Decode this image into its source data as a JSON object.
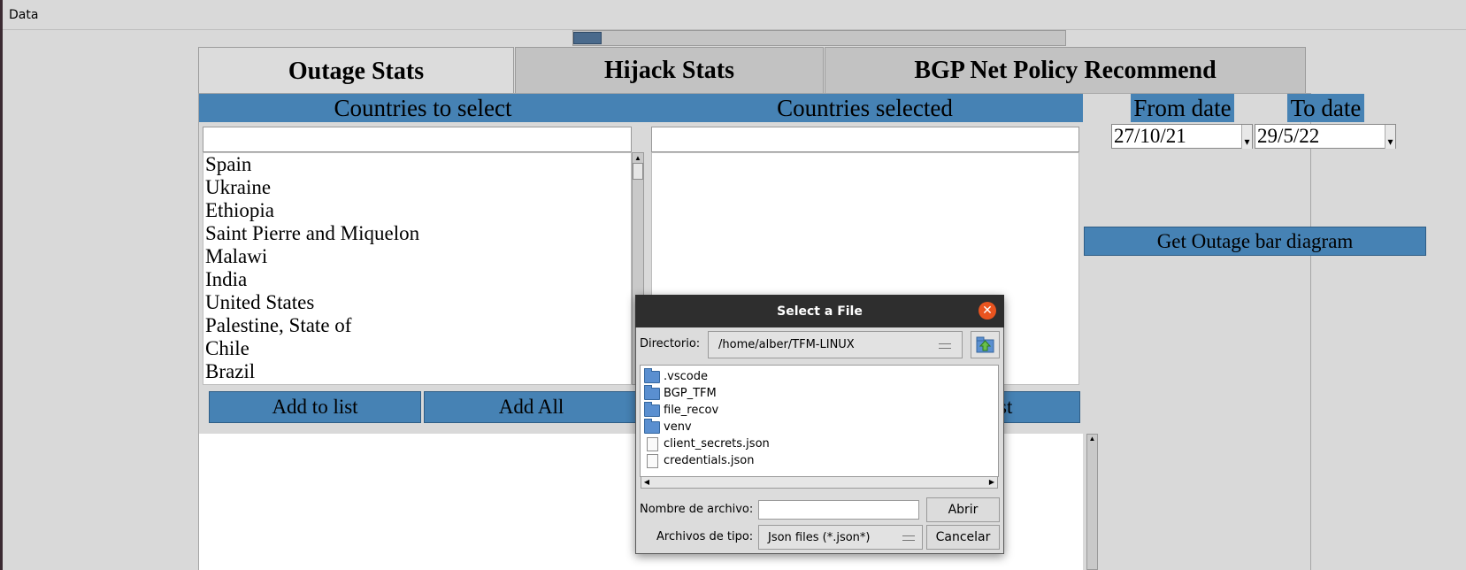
{
  "menu": {
    "data_label": "Data"
  },
  "tabs": [
    {
      "label": "Outage Stats"
    },
    {
      "label": "Hijack Stats"
    },
    {
      "label": "BGP Net Policy Recommend"
    }
  ],
  "outage": {
    "countries_to_select_header": "Countries to select",
    "countries_selected_header": "Countries selected",
    "search_value": "",
    "selected_search_value": "",
    "countries": [
      "Spain",
      "Ukraine",
      "Ethiopia",
      "Saint Pierre and Miquelon",
      "Malawi",
      "India",
      "United States",
      "Palestine, State of",
      "Chile",
      "Brazil"
    ],
    "add_to_list_label": "Add to list",
    "add_all_label": "Add All",
    "remove_partial_label": "st",
    "from_date_label": "From date",
    "to_date_label": "To date",
    "from_date_value": "27/10/21",
    "to_date_value": "29/5/22",
    "get_bar_diagram_label": "Get Outage bar diagram"
  },
  "dialog": {
    "title": "Select a File",
    "directory_label": "Directorio:",
    "directory_value": "/home/alber/TFM-LINUX",
    "files": [
      {
        "name": ".vscode",
        "icon": "folder-icon"
      },
      {
        "name": "BGP_TFM",
        "icon": "folder-icon"
      },
      {
        "name": "file_recov",
        "icon": "folder-icon"
      },
      {
        "name": "venv",
        "icon": "folder-icon"
      },
      {
        "name": "client_secrets.json",
        "icon": "file-icon"
      },
      {
        "name": "credentials.json",
        "icon": "file-icon"
      }
    ],
    "filename_label": "Nombre de archivo:",
    "filename_value": "",
    "filetype_label": "Archivos de tipo:",
    "filetype_value": "Json files (*.json*)",
    "open_label": "Abrir",
    "cancel_label": "Cancelar"
  },
  "colors": {
    "accent": "#4682b4",
    "dialog_title_bg": "#2e2e2e",
    "close_button": "#e9541f"
  }
}
